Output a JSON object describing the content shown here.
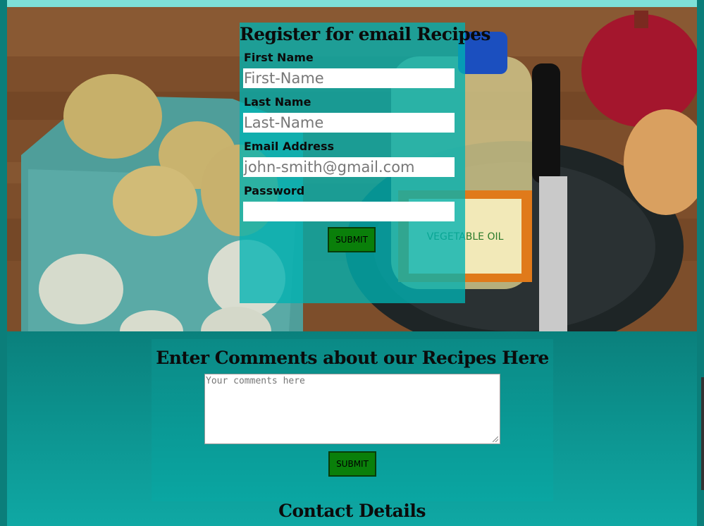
{
  "register": {
    "title": "Register for email Recipes",
    "first_name_label": "First Name",
    "first_name_placeholder": "First-Name",
    "last_name_label": "Last Name",
    "last_name_placeholder": "Last-Name",
    "email_label": "Email Address",
    "email_placeholder": "john-smith@gmail.com",
    "password_label": "Password",
    "password_value": "",
    "submit_label": "SUBMIT"
  },
  "comments": {
    "title": "Enter Comments about our Recipes Here",
    "placeholder": "Your comments here",
    "submit_label": "SUBMIT"
  },
  "contact": {
    "title": "Contact Details"
  },
  "hero": {
    "bottle_label": "VEGETABLE OIL"
  },
  "colors": {
    "accent_teal": "#00b2b2",
    "submit_green": "#0a7f0a",
    "top_strip": "#7ee0d8"
  }
}
